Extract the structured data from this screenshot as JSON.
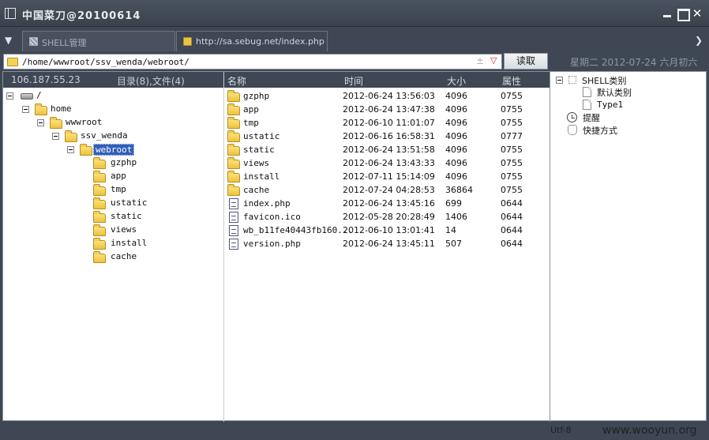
{
  "window": {
    "title": "中国菜刀@20100614"
  },
  "tabs": [
    {
      "label": "SHELL管理"
    },
    {
      "label": "http://sa.sebug.net/index.php"
    }
  ],
  "address": {
    "path": "/home/wwwroot/ssv_wenda/webroot/",
    "read_label": "读取",
    "date": "星期二 2012-07-24 六月初六"
  },
  "info": {
    "ip": "106.187.55.23",
    "counts": "目录(8),文件(4)"
  },
  "columns": {
    "name": "名称",
    "time": "时间",
    "size": "大小",
    "attr": "属性"
  },
  "tree": {
    "root": "/",
    "home": "home",
    "wwwroot": "wwwroot",
    "ssv_wenda": "ssv_wenda",
    "webroot": "webroot",
    "children": [
      "gzphp",
      "app",
      "tmp",
      "ustatic",
      "static",
      "views",
      "install",
      "cache"
    ]
  },
  "files": [
    {
      "name": "gzphp",
      "time": "2012-06-24 13:56:03",
      "size": "4096",
      "attr": "0755",
      "type": "folder"
    },
    {
      "name": "app",
      "time": "2012-06-24 13:47:38",
      "size": "4096",
      "attr": "0755",
      "type": "folder"
    },
    {
      "name": "tmp",
      "time": "2012-06-10 11:01:07",
      "size": "4096",
      "attr": "0755",
      "type": "folder"
    },
    {
      "name": "ustatic",
      "time": "2012-06-16 16:58:31",
      "size": "4096",
      "attr": "0777",
      "type": "folder"
    },
    {
      "name": "static",
      "time": "2012-06-24 13:51:58",
      "size": "4096",
      "attr": "0755",
      "type": "folder"
    },
    {
      "name": "views",
      "time": "2012-06-24 13:43:33",
      "size": "4096",
      "attr": "0755",
      "type": "folder"
    },
    {
      "name": "install",
      "time": "2012-07-11 15:14:09",
      "size": "4096",
      "attr": "0755",
      "type": "folder"
    },
    {
      "name": "cache",
      "time": "2012-07-24 04:28:53",
      "size": "36864",
      "attr": "0755",
      "type": "folder"
    },
    {
      "name": "index.php",
      "time": "2012-06-24 13:45:16",
      "size": "699",
      "attr": "0644",
      "type": "file"
    },
    {
      "name": "favicon.ico",
      "time": "2012-05-28 20:28:49",
      "size": "1406",
      "attr": "0644",
      "type": "file"
    },
    {
      "name": "wb_b11fe40443fb160...",
      "time": "2012-06-10 13:01:41",
      "size": "14",
      "attr": "0644",
      "type": "file"
    },
    {
      "name": "version.php",
      "time": "2012-06-24 13:45:11",
      "size": "507",
      "attr": "0644",
      "type": "file"
    }
  ],
  "right_tree": {
    "shell_category": "SHELL类别",
    "default_category": "默认类别",
    "type1": "Type1",
    "reminder": "提醒",
    "shortcuts": "快捷方式"
  },
  "status": {
    "encoding": "Utf-8",
    "watermark": "www.wooyun.org"
  }
}
